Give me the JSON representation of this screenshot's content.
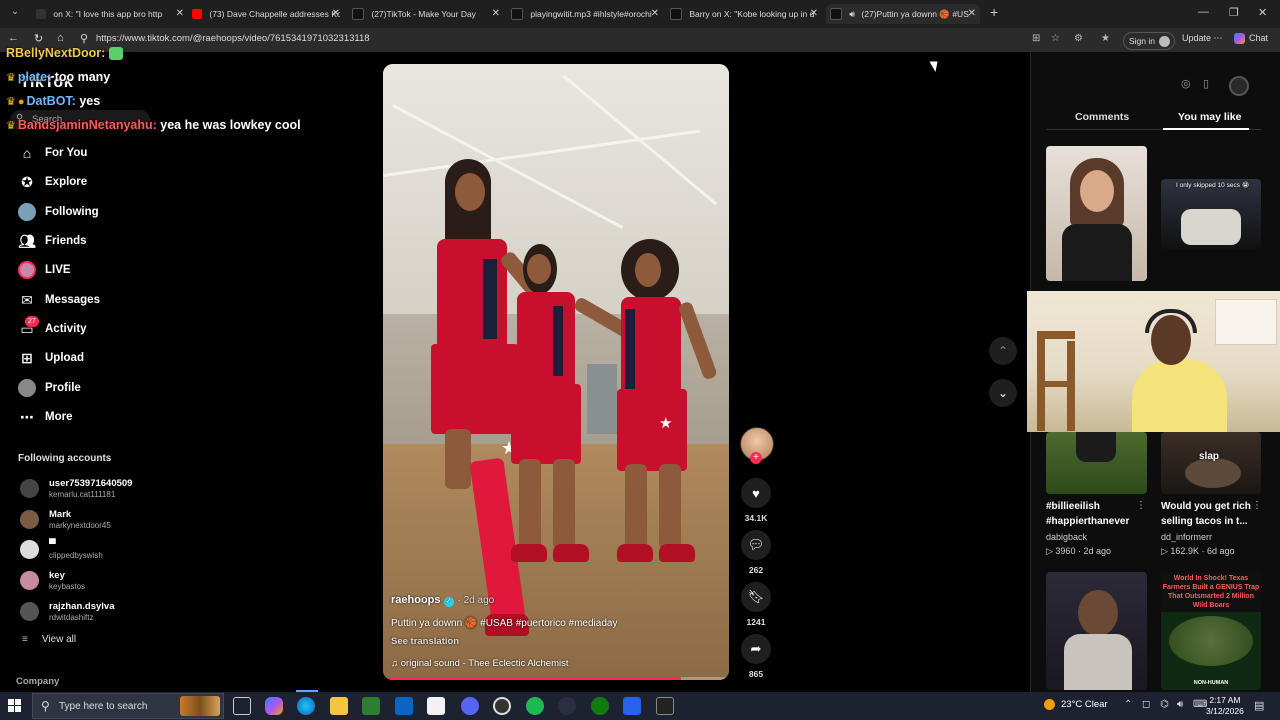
{
  "browser": {
    "tabs": [
      {
        "label": "on X: \"I love this app bro http",
        "color": "#444"
      },
      {
        "label": "(73) Dave Chappelle addresses Ko",
        "color": "#ff0000"
      },
      {
        "label": "(27)TikTok - Make Your Day",
        "color": "#111"
      },
      {
        "label": "playingwitit.mp3 #ihlstyle#orochi",
        "color": "#111"
      },
      {
        "label": "Barry on X: \"Kobe looking up in d",
        "color": "#111"
      },
      {
        "label": "(27)Puttin ya downn 🏀 #US",
        "color": "#111"
      }
    ],
    "url": "https://www.tiktok.com/@raehoops/video/7615341971032313118",
    "sign_in": "Sign in",
    "update": "Update",
    "chat": "Chat"
  },
  "tiktok": {
    "logo": "TikTok",
    "search_placeholder": "Search",
    "nav": [
      {
        "label": "For You",
        "icon": "home-icon"
      },
      {
        "label": "Explore",
        "icon": "compass-icon"
      },
      {
        "label": "Following",
        "icon": "avatar-icon"
      },
      {
        "label": "Friends",
        "icon": "friends-icon"
      },
      {
        "label": "LIVE",
        "icon": "live-icon"
      },
      {
        "label": "Messages",
        "icon": "messages-icon"
      },
      {
        "label": "Activity",
        "icon": "activity-icon"
      },
      {
        "label": "Upload",
        "icon": "upload-icon"
      },
      {
        "label": "Profile",
        "icon": "profile-icon"
      },
      {
        "label": "More",
        "icon": "more-icon"
      }
    ],
    "activity_badge": "27",
    "following_header": "Following accounts",
    "following": [
      {
        "name": "user753971640509",
        "handle": "kemarlu.cat111181",
        "color": "#444"
      },
      {
        "name": "Mark",
        "handle": "markynextdoor45",
        "color": "#7a5c44"
      },
      {
        "name": "▀",
        "handle": "clippedbyswish",
        "color": "#ddd"
      },
      {
        "name": "key",
        "handle": "keybastos",
        "color": "#c88aa0"
      },
      {
        "name": "rajzhan.dsylva",
        "handle": "rdwitdashiftz",
        "color": "#555"
      }
    ],
    "view_all": "View all",
    "company": "Company"
  },
  "chat_overlay": [
    {
      "user": "RBellyNextDoor:",
      "msg": "",
      "color": "#f2c94c"
    },
    {
      "user": "plate:",
      "msg": "too many",
      "color": "#6fb7ff"
    },
    {
      "user": "DatBOT:",
      "msg": "yes",
      "color": "#6fb7ff"
    },
    {
      "user": "BandsjaminNetanyahu:",
      "msg": "yea he was lowkey cool",
      "color": "#ff5a5a"
    }
  ],
  "video": {
    "author": "raehoops",
    "time_ago": "· 2d ago",
    "caption": "Puttin ya downn 🏀 #USAB #puertorico #mediaday",
    "see_translation": "See translation",
    "sound": "♫  original sound - Thee Eclectic Alchemist",
    "progress": 0.86,
    "likes": "34.1K",
    "comments": "262",
    "saves": "1241",
    "shares": "865"
  },
  "right_panel": {
    "tab_comments": "Comments",
    "tab_you_may_like": "You may like",
    "thumb_overlay_text": "I only skipped 10 secs 😭",
    "items": [
      {
        "title1": "#billieeilish",
        "title2": "#happierthanever",
        "user": "dabigback",
        "meta": "▷ 3960 · 2d ago"
      },
      {
        "title1": "Would you get rich",
        "title2": "selling tacos in t...",
        "user": "dd_informerr",
        "meta": "▷ 162.9K · 6d ago",
        "overlay": "slap"
      }
    ],
    "texas_headline": "World In Shock! Texas Farmers Built a GENIUS Trap That Outsmarted 2 Million Wild Boars",
    "texas_foot": "NON-HUMAN"
  },
  "taskbar": {
    "search_placeholder": "Type here to search",
    "weather": "23°C  Clear",
    "time": "2:17 AM",
    "date": "3/12/2026"
  }
}
